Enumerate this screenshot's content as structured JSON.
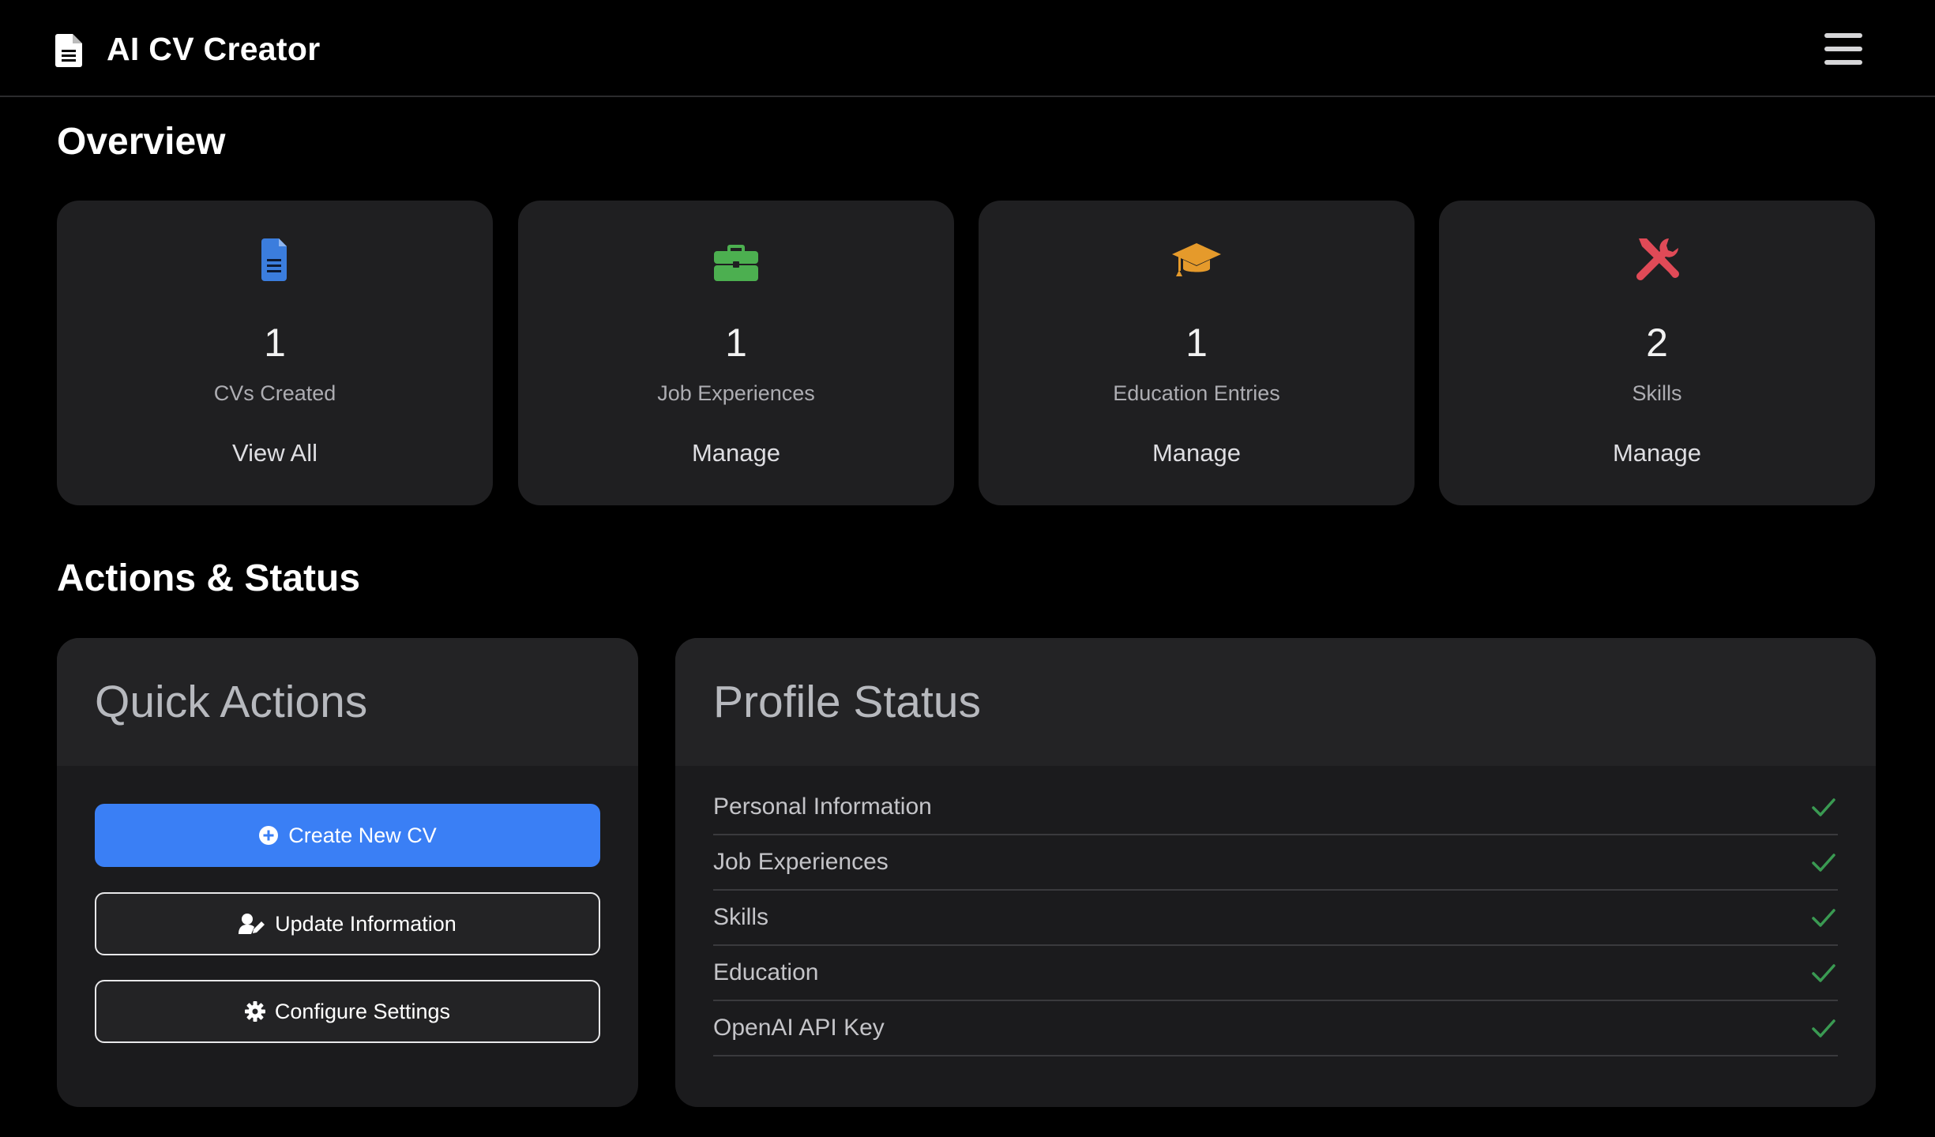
{
  "app": {
    "title": "AI CV Creator",
    "brand_icon": "file-document-icon",
    "menu_icon": "hamburger-menu-icon"
  },
  "sections": {
    "overview": "Overview",
    "actions_status": "Actions & Status"
  },
  "stats": [
    {
      "icon": "file-document-icon",
      "icon_color": "#3b7ddd",
      "count": "1",
      "label": "CVs Created",
      "link": "View All"
    },
    {
      "icon": "briefcase-icon",
      "icon_color": "#4caf50",
      "count": "1",
      "label": "Job Experiences",
      "link": "Manage"
    },
    {
      "icon": "graduation-cap-icon",
      "icon_color": "#e59a2b",
      "count": "1",
      "label": "Education Entries",
      "link": "Manage"
    },
    {
      "icon": "tools-icon",
      "icon_color": "#e04a57",
      "count": "2",
      "label": "Skills",
      "link": "Manage"
    }
  ],
  "quick_actions": {
    "title": "Quick Actions",
    "buttons": [
      {
        "label": "Create New CV",
        "icon": "plus-circle-icon"
      },
      {
        "label": "Update Information",
        "icon": "user-edit-icon"
      },
      {
        "label": "Configure Settings",
        "icon": "gear-icon"
      }
    ]
  },
  "profile_status": {
    "title": "Profile Status",
    "items": [
      {
        "label": "Personal Information",
        "complete": true
      },
      {
        "label": "Job Experiences",
        "complete": true
      },
      {
        "label": "Skills",
        "complete": true
      },
      {
        "label": "Education",
        "complete": true
      },
      {
        "label": "OpenAI API Key",
        "complete": true
      }
    ],
    "check_icon": "check-icon",
    "check_color": "#3a9a52"
  },
  "colors": {
    "background": "#000000",
    "card": "#1f1f21",
    "primary": "#3a7ff5"
  }
}
